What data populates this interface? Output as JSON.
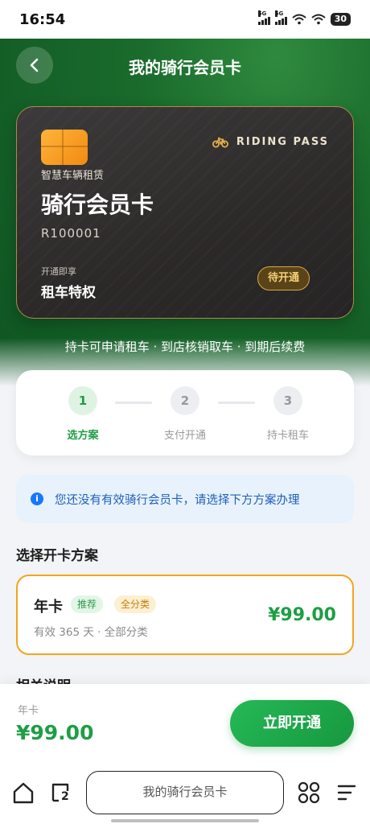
{
  "status_bar": {
    "time": "16:54",
    "signal1": "5G",
    "signal2": "5G",
    "battery": "30"
  },
  "header": {
    "title": "我的骑行会员卡"
  },
  "card": {
    "badge": "RIDING PASS",
    "brand": "智慧车辆租赁",
    "title": "骑行会员卡",
    "number": "R100001",
    "privilege_caption": "开通即享",
    "privilege": "租车特权",
    "status": "待开通",
    "accent_color": "#b08a4a"
  },
  "flow_text": "持卡可申请租车 · 到店核销取车 · 到期后续费",
  "steps": [
    {
      "num": "1",
      "label": "选方案",
      "active": true
    },
    {
      "num": "2",
      "label": "支付开通",
      "active": false
    },
    {
      "num": "3",
      "label": "持卡租车",
      "active": false
    }
  ],
  "notice": {
    "icon": "info-icon",
    "text": "您还没有有效骑行会员卡，请选择下方方案办理"
  },
  "plans_section": {
    "title": "选择开卡方案"
  },
  "plan": {
    "name": "年卡",
    "tag_recommend": "推荐",
    "tag_category": "全分类",
    "description": "有效 365 天 · 全部分类",
    "price": "¥99.00",
    "selected": true
  },
  "next_section": {
    "title": "相关说明"
  },
  "bottom_bar": {
    "label": "年卡",
    "price": "¥99.00",
    "button": "立即开通"
  },
  "browser": {
    "url_text": "我的骑行会员卡",
    "tab_count": "2"
  },
  "colors": {
    "brand_green": "#1e9e45",
    "hero_green": "#1a6b2c",
    "highlight_orange": "#f3a51c"
  }
}
